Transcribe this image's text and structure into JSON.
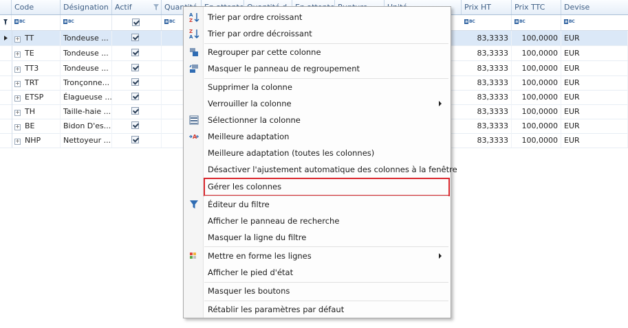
{
  "columns": [
    "Code",
    "Désignation",
    "Actif",
    "Quantité",
    "En attente",
    "Quantité d",
    "En attente",
    "Rupture",
    "Unité",
    "Prix HT",
    "Prix TTC",
    "Devise"
  ],
  "rows": [
    {
      "code": "TT",
      "designation": "Tondeuse ...",
      "prix_ht": "83,3333",
      "prix_ttc": "100,0000",
      "devise": "EUR"
    },
    {
      "code": "TE",
      "designation": "Tondeuse ...",
      "prix_ht": "83,3333",
      "prix_ttc": "100,0000",
      "devise": "EUR"
    },
    {
      "code": "TT3",
      "designation": "Tondeuse ...",
      "prix_ht": "83,3333",
      "prix_ttc": "100,0000",
      "devise": "EUR"
    },
    {
      "code": "TRT",
      "designation": "Tronçonne...",
      "prix_ht": "83,3333",
      "prix_ttc": "100,0000",
      "devise": "EUR"
    },
    {
      "code": "ETSP",
      "designation": "Élagueuse ...",
      "prix_ht": "83,3333",
      "prix_ttc": "100,0000",
      "devise": "EUR"
    },
    {
      "code": "TH",
      "designation": "Taille-haie ...",
      "prix_ht": "83,3333",
      "prix_ttc": "100,0000",
      "devise": "EUR"
    },
    {
      "code": "BE",
      "designation": "Bidon D'es...",
      "prix_ht": "83,3333",
      "prix_ttc": "100,0000",
      "devise": "EUR"
    },
    {
      "code": "NHP",
      "designation": "Nettoyeur ...",
      "prix_ht": "83,3333",
      "prix_ttc": "100,0000",
      "devise": "EUR"
    }
  ],
  "menu": {
    "sort_asc": "Trier par ordre croissant",
    "sort_desc": "Trier par ordre décroissant",
    "group_by": "Regrouper par cette colonne",
    "hide_group_panel": "Masquer le panneau de regroupement",
    "delete_column": "Supprimer la colonne",
    "lock_column": "Verrouiller la colonne",
    "select_column": "Sélectionner la colonne",
    "best_fit": "Meilleure adaptation",
    "best_fit_all": "Meilleure adaptation (toutes les colonnes)",
    "disable_autofit": "Désactiver l'ajustement automatique des colonnes à la fenêtre",
    "manage_columns": "Gérer les colonnes",
    "filter_editor": "Éditeur du filtre",
    "show_search_panel": "Afficher le panneau de recherche",
    "hide_filter_row": "Masquer la ligne du filtre",
    "format_rows": "Mettre en forme les lignes",
    "show_footer": "Afficher le pied d'état",
    "hide_buttons": "Masquer les boutons",
    "reset_defaults": "Rétablir les paramètres par défaut"
  },
  "colors": {
    "highlight_border": "#d9262c",
    "selected_row": "#dbe8f7",
    "header_text": "#3f5f85"
  }
}
